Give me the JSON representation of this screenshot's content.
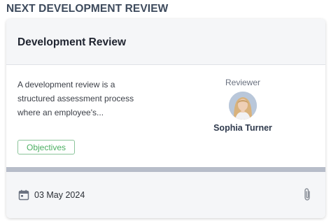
{
  "section": {
    "title": "NEXT DEVELOPMENT REVIEW"
  },
  "card": {
    "title": "Development Review",
    "description": "A development review is a structured assessment process where an employee's...",
    "reviewer": {
      "label": "Reviewer",
      "name": "Sophia Turner"
    },
    "tag": "Objectives",
    "date": "03 May 2024",
    "icons": {
      "date": "calendar-icon",
      "attachment": "paperclip-icon"
    }
  },
  "colors": {
    "tag_green": "#4caf62",
    "divider": "#b7bdc9",
    "heading": "#3d4a5c"
  }
}
